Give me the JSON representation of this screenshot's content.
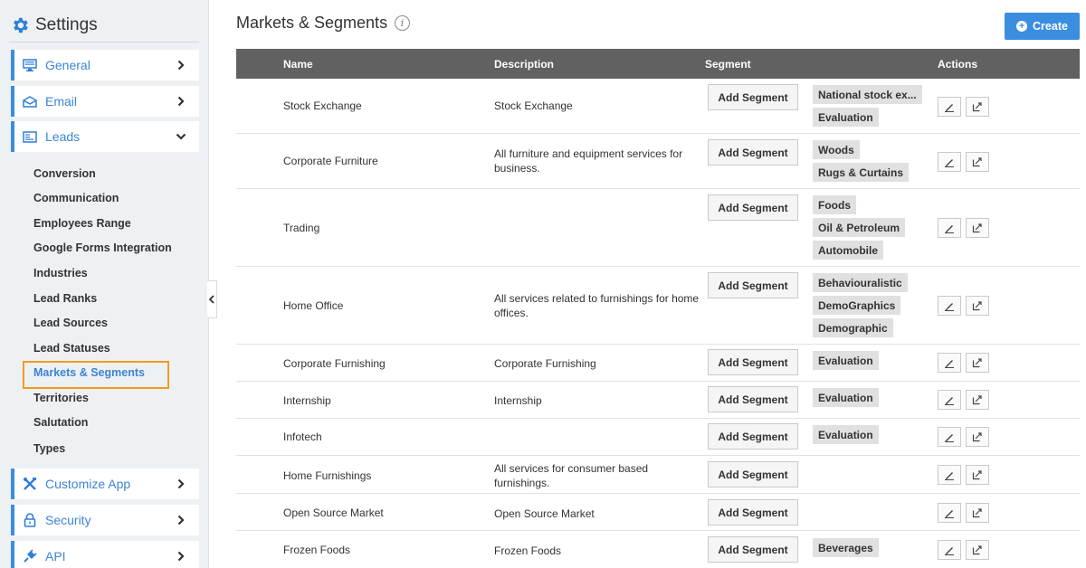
{
  "sidebar": {
    "title": "Settings",
    "items": [
      {
        "label": "General",
        "icon": "monitor-icon"
      },
      {
        "label": "Email",
        "icon": "envelope-icon"
      },
      {
        "label": "Leads",
        "icon": "leads-card-icon"
      },
      {
        "label": "Customize App",
        "icon": "tools-icon"
      },
      {
        "label": "Security",
        "icon": "lock-icon"
      },
      {
        "label": "API",
        "icon": "plug-icon"
      }
    ],
    "leads_sub": [
      "Conversion",
      "Communication",
      "Employees Range",
      "Google Forms Integration",
      "Industries",
      "Lead Ranks",
      "Lead Sources",
      "Lead Statuses",
      "Markets & Segments",
      "Territories",
      "Salutation",
      "Types"
    ],
    "active_sub": "Markets & Segments"
  },
  "header": {
    "title": "Markets & Segments",
    "create_label": "Create"
  },
  "table": {
    "columns": [
      "Name",
      "Description",
      "Segment",
      "Actions"
    ],
    "add_segment_label": "Add Segment",
    "rows": [
      {
        "name": "Stock Exchange",
        "desc": "Stock Exchange",
        "segments": [
          "National stock ex...",
          "Evaluation"
        ]
      },
      {
        "name": "Corporate Furniture",
        "desc": "All furniture and equipment services for business.",
        "segments": [
          "Woods",
          "Rugs & Curtains"
        ]
      },
      {
        "name": "Trading",
        "desc": "",
        "segments": [
          "Foods",
          "Oil & Petroleum",
          "Automobile"
        ]
      },
      {
        "name": "Home Office",
        "desc": "All services related to furnishings for home offices.",
        "segments": [
          "Behaviouralistic",
          "DemoGraphics",
          "Demographic"
        ]
      },
      {
        "name": "Corporate Furnishing",
        "desc": "Corporate Furnishing",
        "segments": [
          "Evaluation"
        ]
      },
      {
        "name": "Internship",
        "desc": "Internship",
        "segments": [
          "Evaluation"
        ]
      },
      {
        "name": "Infotech",
        "desc": "",
        "segments": [
          "Evaluation"
        ]
      },
      {
        "name": "Home Furnishings",
        "desc": "All services for consumer based furnishings.",
        "segments": []
      },
      {
        "name": "Open Source Market",
        "desc": "Open Source Market",
        "segments": []
      },
      {
        "name": "Frozen Foods",
        "desc": "Frozen Foods",
        "segments": [
          "Beverages"
        ]
      }
    ]
  },
  "colors": {
    "accent": "#3b8de0",
    "header_bg": "#616161",
    "highlight": "#f39a1f"
  }
}
